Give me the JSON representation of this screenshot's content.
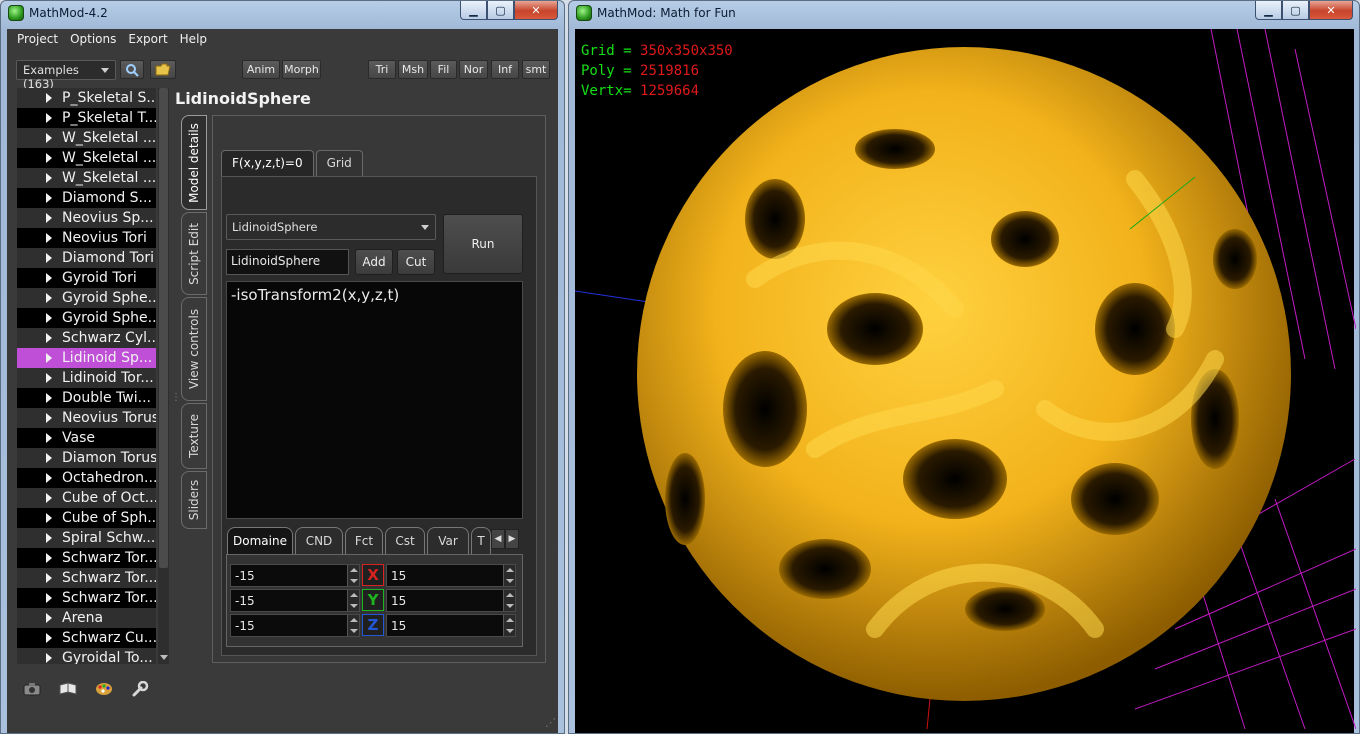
{
  "left_window": {
    "title": "MathMod-4.2",
    "window_buttons": {
      "minimize": "▁",
      "maximize": "▢",
      "close": "✕"
    },
    "menu": [
      "Project",
      "Options",
      "Export",
      "Help"
    ],
    "toolbar": {
      "examples_combo": "Examples (163)",
      "search_icon": "magnifier-icon",
      "open_icon": "folder-icon",
      "anim": "Anim",
      "morph": "Morph",
      "tri": "Tri",
      "msh": "Msh",
      "fil": "Fil",
      "nor": "Nor",
      "inf": "Inf",
      "smt": "smt"
    },
    "tree_items": [
      "P_Skeletal S...",
      "P_Skeletal T...",
      "W_Skeletal ...",
      "W_Skeletal ...",
      "W_Skeletal ...",
      "Diamond S...",
      "Neovius Sp...",
      "Neovius Tori",
      "Diamond Tori",
      "Gyroid Tori",
      "Gyroid Sphe...",
      "Gyroid Sphe...",
      "Schwarz Cyl...",
      "Lidinoid Sp...",
      "Lidinoid Tor...",
      "Double Twi...",
      "Neovius Torus",
      "Vase",
      "Diamon Torus",
      "Octahedron...",
      "Cube of Oct...",
      "Cube of Sph...",
      "Spiral Schw...",
      "Schwarz Tor...",
      "Schwarz Tor...",
      "Schwarz Tor...",
      "Arena",
      "Schwarz Cu...",
      "Gyroidal To..."
    ],
    "selected_tree_index": 13,
    "model_title": "LidinoidSphere",
    "vertical_tabs": [
      "Model details",
      "Script Edit",
      "View controls",
      "Texture",
      "Sliders"
    ],
    "horizontal_tabs": [
      "F(x,y,z,t)=0",
      "Grid"
    ],
    "function_combo": "LidinoidSphere",
    "function_name_input": "LidinoidSphere",
    "add_button": "Add",
    "cut_button": "Cut",
    "run_button": "Run",
    "editor_text": "-isoTransform2(x,y,z,t)",
    "bottom_tabs": [
      "Domaine",
      "CND",
      "Fct",
      "Cst",
      "Var",
      "T"
    ],
    "domain": [
      {
        "axis": "X",
        "min": "-15",
        "max": "15",
        "color": "#d8231e"
      },
      {
        "axis": "Y",
        "min": "-15",
        "max": "15",
        "color": "#1fb51f"
      },
      {
        "axis": "Z",
        "min": "-15",
        "max": "15",
        "color": "#2257d6"
      }
    ],
    "bottom_icons": [
      "camera-icon",
      "book-icon",
      "palette-icon",
      "wrench-icon"
    ]
  },
  "right_window": {
    "title": "MathMod: Math for Fun",
    "window_buttons": {
      "minimize": "▁",
      "maximize": "▢",
      "close": "✕"
    },
    "stats": [
      {
        "label": "Grid = ",
        "value": "350x350x350"
      },
      {
        "label": "Poly = ",
        "value": "2519816"
      },
      {
        "label": "Vertx= ",
        "value": "1259664"
      }
    ],
    "surface_color": "#f2b21b",
    "grid_color": "#c21bc4"
  }
}
